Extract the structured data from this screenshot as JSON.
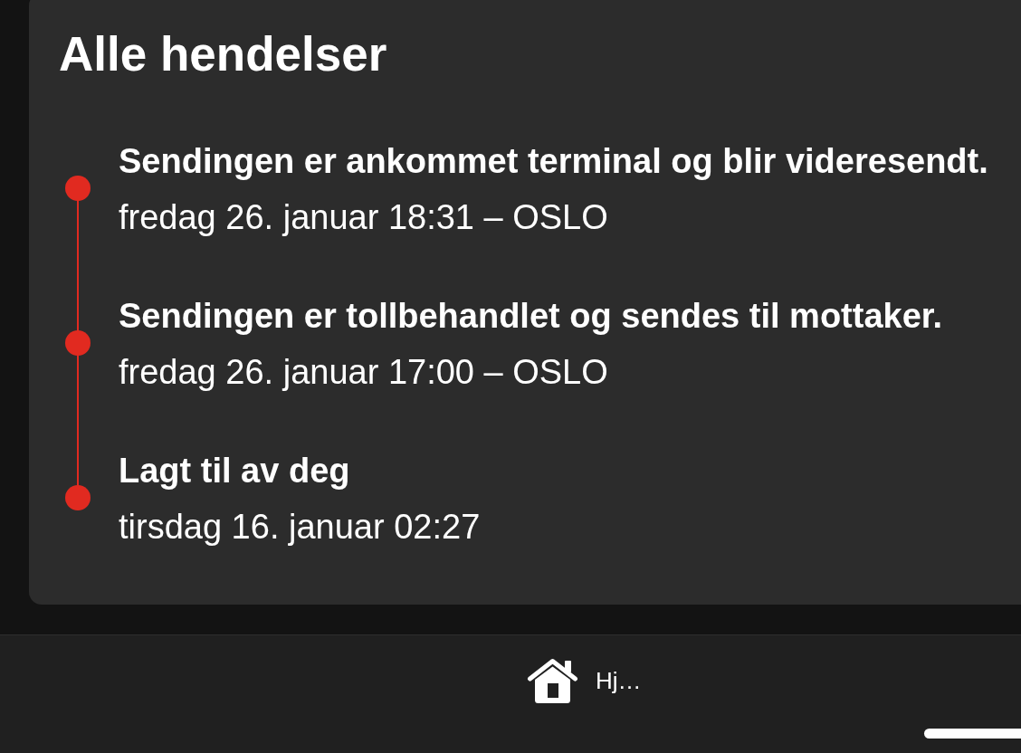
{
  "page": {
    "title": "Alle hendelser"
  },
  "events": [
    {
      "description": "Sendingen er ankommet terminal og blir videresendt.",
      "time": "fredag 26. januar 18:31 – OSLO"
    },
    {
      "description": "Sendingen er tollbehandlet og sendes til mottaker.",
      "time": "fredag 26. januar 17:00 – OSLO"
    },
    {
      "description": "Lagt til av deg",
      "time": "tirsdag 16. januar 02:27"
    }
  ],
  "tab_bar": {
    "items": [
      {
        "label": "Hj…"
      }
    ]
  }
}
